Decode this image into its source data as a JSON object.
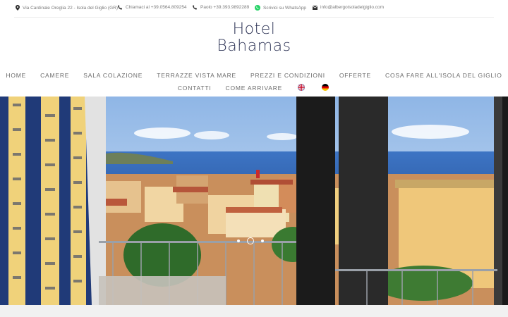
{
  "topbar": {
    "address": "Via Cardinale Oreglia 22 - Isola del Giglio (GR)",
    "call": "Chiamaci al +39.0564.809254",
    "paolo": "Paolo +39.393.9892289",
    "whatsapp": "Scrivici su WhatsApp",
    "email": "info@albergoisoladelgiglio.com"
  },
  "logo": {
    "line1": "Hotel",
    "line2": "Bahamas"
  },
  "nav": {
    "row1": [
      "HOME",
      "CAMERE",
      "SALA COLAZIONE",
      "TERRAZZE VISTA MARE",
      "PREZZI E CONDIZIONI",
      "OFFERTE",
      "COSA FARE ALL'ISOLA DEL GIGLIO"
    ],
    "row2": [
      "CONTATTI",
      "COME ARRIVARE"
    ]
  },
  "icons": {
    "address": "map-pin-icon",
    "call": "phone-icon",
    "paolo": "phone-icon",
    "whatsapp": "whatsapp-icon",
    "email": "mail-icon"
  },
  "colors": {
    "logo": "#2f3557",
    "whatsapp": "#25d366",
    "nav_text": "#6b6b6b"
  },
  "slider": {
    "total": 3,
    "active": 2
  }
}
